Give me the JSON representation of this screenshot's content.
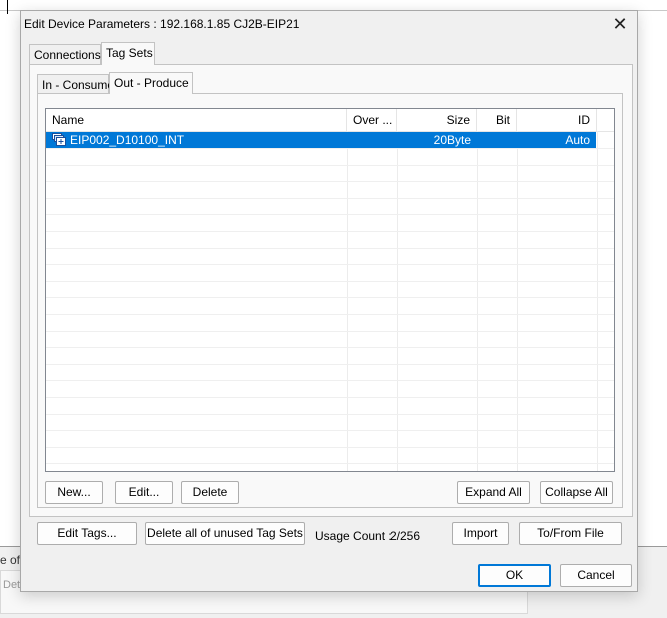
{
  "background": {
    "text_fragment_1": "e of I",
    "text_fragment_2": "Det"
  },
  "dialog": {
    "title": "Edit Device Parameters : 192.168.1.85 CJ2B-EIP21",
    "close_icon": "close-icon",
    "tabs": [
      {
        "label": "Connections",
        "active": false
      },
      {
        "label": "Tag Sets",
        "active": true
      }
    ],
    "subtabs": [
      {
        "label": "In - Consume",
        "active": false
      },
      {
        "label": "Out - Produce",
        "active": true
      }
    ],
    "table": {
      "columns": [
        "Name",
        "Over ...",
        "Size",
        "Bit",
        "ID"
      ],
      "rows": [
        {
          "icon": "tag-set-icon",
          "name": "EIP002_D10100_INT",
          "over": "",
          "size": "20Byte",
          "bit": "",
          "id": "Auto",
          "selected": true
        }
      ]
    },
    "panel_buttons": {
      "new": "New...",
      "edit": "Edit...",
      "delete": "Delete",
      "expand_all": "Expand All",
      "collapse_all": "Collapse All"
    },
    "bottom": {
      "edit_tags": "Edit Tags...",
      "delete_unused": "Delete all of unused Tag Sets",
      "usage_count_label": "Usage Count :",
      "usage_count_value": "2/256",
      "import": "Import",
      "to_from_file": "To/From File"
    },
    "footer": {
      "ok": "OK",
      "cancel": "Cancel"
    },
    "colors": {
      "selection": "#0078d7",
      "default_button_border": "#0078d7"
    }
  }
}
